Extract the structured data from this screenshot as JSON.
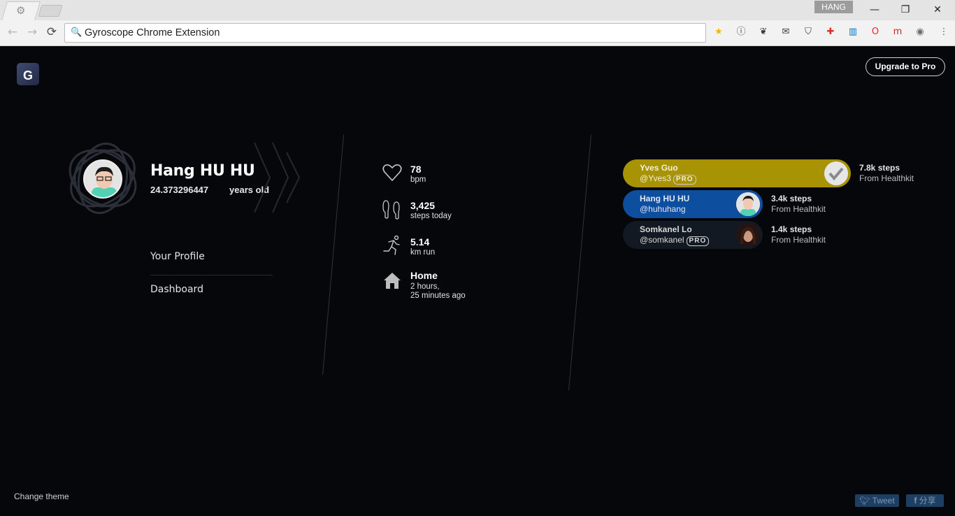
{
  "browser": {
    "omnibox_text": "Gyroscope Chrome Extension",
    "user_badge": "HANG",
    "back_icon": "←",
    "forward_icon": "→",
    "reload_icon": "⟳",
    "search_icon": "🔍",
    "minimize_icon": "—",
    "restore_icon": "❐",
    "close_icon": "✕",
    "tab_icon": "⚙",
    "extensions": [
      {
        "name": "star-icon",
        "glyph": "★",
        "color": "#f4b400"
      },
      {
        "name": "onepassword-icon",
        "glyph": "ⓘ",
        "color": "#3a3a3a"
      },
      {
        "name": "evernote-icon",
        "glyph": "❦",
        "color": "#3a3a3a"
      },
      {
        "name": "mail-icon",
        "glyph": "✉",
        "color": "#3a3a3a"
      },
      {
        "name": "pocket-icon",
        "glyph": "⛉",
        "color": "#3a3a3a"
      },
      {
        "name": "plus-extension-icon",
        "glyph": "✚",
        "color": "#d93025"
      },
      {
        "name": "trello-icon",
        "glyph": "▥",
        "color": "#0079bf"
      },
      {
        "name": "opera-icon",
        "glyph": "O",
        "color": "#ff1b2d"
      },
      {
        "name": "m-extension-icon",
        "glyph": "m",
        "color": "#c62828"
      },
      {
        "name": "record-extension-icon",
        "glyph": "◉",
        "color": "#6c6c6c"
      },
      {
        "name": "menu-icon",
        "glyph": "⋮",
        "color": "#5a5a5a"
      }
    ]
  },
  "app": {
    "logo_letter": "G",
    "upgrade_label": "Upgrade to Pro"
  },
  "profile": {
    "name": "Hang HU HU",
    "age": "24.373296447",
    "age_unit": "years old"
  },
  "menu": {
    "profile_label": "Your Profile",
    "dashboard_label": "Dashboard"
  },
  "stats": {
    "heart": {
      "value": "78",
      "unit": "bpm",
      "icon": "heart-icon"
    },
    "steps": {
      "value": "3,425",
      "unit": "steps today",
      "icon": "footprints-icon"
    },
    "run": {
      "value": "5.14",
      "unit": "km run",
      "icon": "running-icon"
    },
    "location": {
      "value": "Home",
      "line1": "2 hours,",
      "line2": "25 minutes ago",
      "icon": "home-icon"
    }
  },
  "leaderboard": [
    {
      "name": "Yves Guo",
      "handle": "@Yves3",
      "pro": "PRO",
      "steps": "7.8k steps",
      "source": "From Healthkit",
      "color": "#a89304"
    },
    {
      "name": "Hang HU HU",
      "handle": "@huhuhang",
      "pro": "",
      "steps": "3.4k steps",
      "source": "From Healthkit",
      "color": "#0d4f9e"
    },
    {
      "name": "Somkanel Lo",
      "handle": "@somkanel",
      "pro": "PRO",
      "steps": "1.4k steps",
      "source": "From Healthkit",
      "color": "#131922"
    }
  ],
  "footer": {
    "change_theme": "Change theme",
    "tweet": "Tweet",
    "share": "分享"
  }
}
